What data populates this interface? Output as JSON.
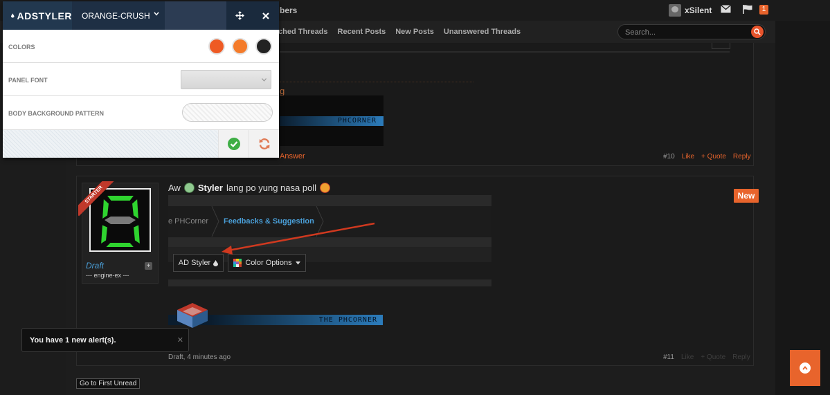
{
  "forum": {
    "breadcrumb_fragment": "bers",
    "nav_links": [
      "ched Threads",
      "Recent Posts",
      "New Posts",
      "Unanswered Threads"
    ],
    "search_placeholder": "Search...",
    "user_name": "xSilent",
    "alerts_count": "1"
  },
  "post10": {
    "text_fragment": "g",
    "banner_text": "PHCORNER",
    "answer_fragment": "Answer",
    "number": "#10",
    "like": "Like",
    "quote": "+ Quote",
    "reply": "Reply"
  },
  "post11": {
    "ribbon": "STARTER",
    "author": "Draft",
    "author_title": "--- engine-ex ---",
    "message_prefix": "Aw",
    "message_bold": "Styler",
    "message_suffix": "lang po yung nasa poll",
    "new_badge": "New",
    "crumb_1": "e PHCorner",
    "crumb_2": "Feedbacks & Suggestion",
    "btn_ad_styler": "AD Styler",
    "btn_color_options": "Color Options",
    "banner_text": "THE PHCORNER",
    "meta": "Draft, 4 minutes ago",
    "number": "#11",
    "like": "Like",
    "quote": "+ Quote",
    "reply": "Reply"
  },
  "go_first_unread": "Go to First Unread",
  "alert": {
    "prefix": "You have",
    "count": "1",
    "suffix": "new alert(s)."
  },
  "styler": {
    "logo_ad": "AD",
    "logo_styler": "STYLER",
    "theme": "ORANGE-CRUSH",
    "rows": {
      "colors": "COLORS",
      "panel_font": "PANEL FONT",
      "body_bg": "BODY BACKGROUND PATTERN"
    },
    "swatches": [
      "#ee5a24",
      "#f47b2a",
      "#222222"
    ]
  },
  "colors": {
    "accent": "#e8642c",
    "link": "#4a9fd8",
    "header": "#15293f"
  }
}
